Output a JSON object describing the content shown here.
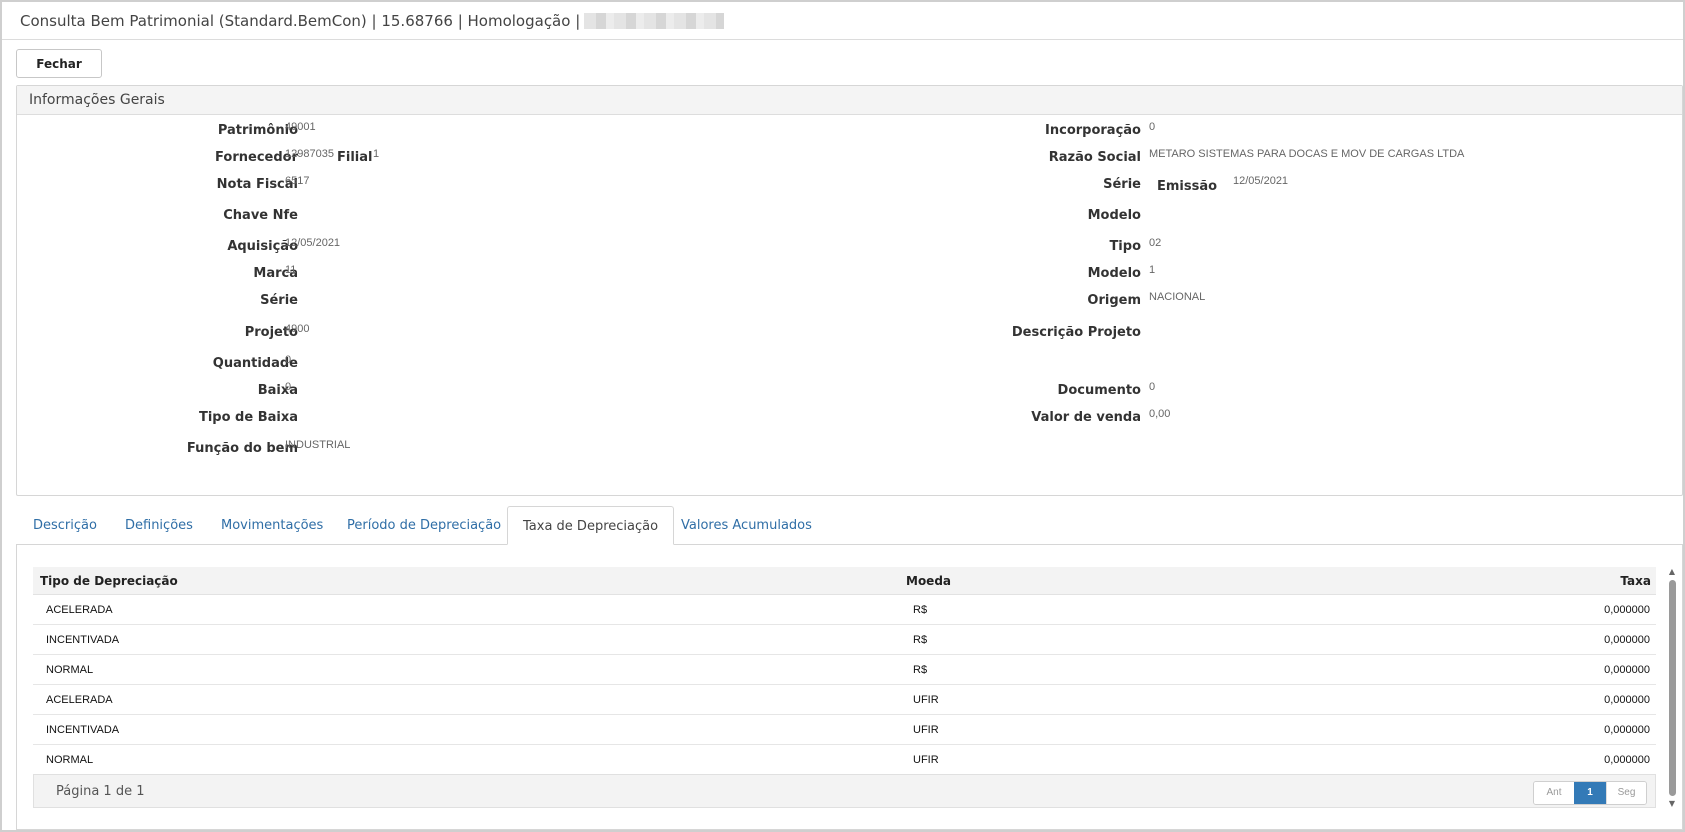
{
  "window": {
    "title": "Consulta Bem Patrimonial (Standard.BemCon) | 15.68766 | Homologação |"
  },
  "toolbar": {
    "close_label": "Fechar"
  },
  "general": {
    "header": "Informações Gerais",
    "left": [
      {
        "label": "Patrimônio",
        "value": "49001"
      },
      {
        "label": "Fornecedor",
        "value": "12987035"
      },
      {
        "label": "Nota Fiscal",
        "value": "6517"
      },
      {
        "label": "Chave Nfe",
        "value": ""
      },
      {
        "label": "Aquisição",
        "value": "12/05/2021"
      },
      {
        "label": "Marca",
        "value": "11"
      },
      {
        "label": "Série",
        "value": ""
      },
      {
        "label": "Projeto",
        "value": "4900"
      },
      {
        "label": "Quantidade",
        "value": "0"
      },
      {
        "label": "Baixa",
        "value": "0"
      },
      {
        "label": "Tipo de Baixa",
        "value": ""
      },
      {
        "label": "Função do bem",
        "value": "INDUSTRIAL"
      }
    ],
    "filial": {
      "label": "Filial",
      "value": "1"
    },
    "right": [
      {
        "label": "Incorporação",
        "value": "0"
      },
      {
        "label": "Razão Social",
        "value": "METARO SISTEMAS PARA DOCAS E MOV DE CARGAS LTDA"
      },
      {
        "label": "Série",
        "value": ""
      },
      {
        "label": "Modelo",
        "value": ""
      },
      {
        "label": "Tipo",
        "value": "02"
      },
      {
        "label": "Modelo",
        "value": "1"
      },
      {
        "label": "Origem",
        "value": "NACIONAL"
      },
      {
        "label": "Descrição Projeto",
        "value": ""
      },
      {
        "label": "Documento",
        "value": "0"
      },
      {
        "label": "Valor de venda",
        "value": "0,00"
      }
    ],
    "emissao": {
      "label": "Emissão",
      "value": "12/05/2021"
    }
  },
  "tabs": [
    {
      "label": "Descrição"
    },
    {
      "label": "Definições"
    },
    {
      "label": "Movimentações"
    },
    {
      "label": "Período de Depreciação"
    },
    {
      "label": "Taxa de Depreciação"
    },
    {
      "label": "Valores Acumulados"
    }
  ],
  "grid": {
    "headers": [
      "Tipo de Depreciação",
      "Moeda",
      "Taxa"
    ],
    "rows": [
      [
        "ACELERADA",
        "R$",
        "0,000000"
      ],
      [
        "INCENTIVADA",
        "R$",
        "0,000000"
      ],
      [
        "NORMAL",
        "R$",
        "0,000000"
      ],
      [
        "ACELERADA",
        "UFIR",
        "0,000000"
      ],
      [
        "INCENTIVADA",
        "UFIR",
        "0,000000"
      ],
      [
        "NORMAL",
        "UFIR",
        "0,000000"
      ]
    ],
    "footer": "Página 1 de 1",
    "pager": {
      "prev": "Ant",
      "current": "1",
      "next": "Seg"
    }
  }
}
